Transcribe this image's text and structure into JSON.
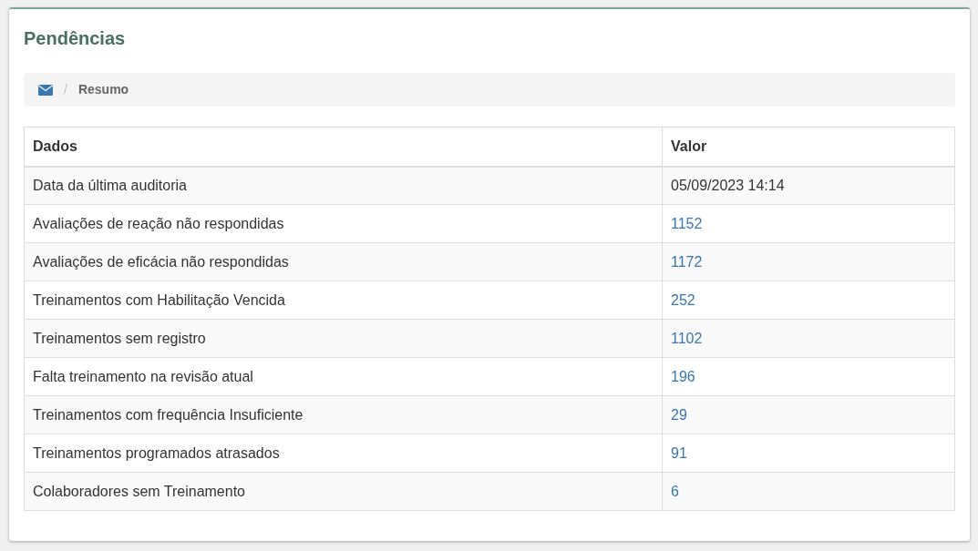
{
  "panel": {
    "title": "Pendências"
  },
  "breadcrumb": {
    "separator": "/",
    "items": [
      "Resumo"
    ]
  },
  "table": {
    "columns": [
      "Dados",
      "Valor"
    ],
    "rows": [
      {
        "label": "Data da última auditoria",
        "value": "05/09/2023 14:14",
        "kind": "text"
      },
      {
        "label": "Avaliações de reação não respondidas",
        "value": "1152",
        "kind": "link"
      },
      {
        "label": "Avaliações de eficácia não respondidas",
        "value": "1172",
        "kind": "link"
      },
      {
        "label": "Treinamentos com Habilitação Vencida",
        "value": "252",
        "kind": "link"
      },
      {
        "label": "Treinamentos sem registro",
        "value": "1102",
        "kind": "link"
      },
      {
        "label": "Falta treinamento na revisão atual",
        "value": "196",
        "kind": "link"
      },
      {
        "label": "Treinamentos com frequência Insuficiente",
        "value": "29",
        "kind": "link"
      },
      {
        "label": "Treinamentos programados atrasados",
        "value": "91",
        "kind": "link"
      },
      {
        "label": "Colaboradores sem Treinamento",
        "value": "6",
        "kind": "link"
      }
    ]
  }
}
